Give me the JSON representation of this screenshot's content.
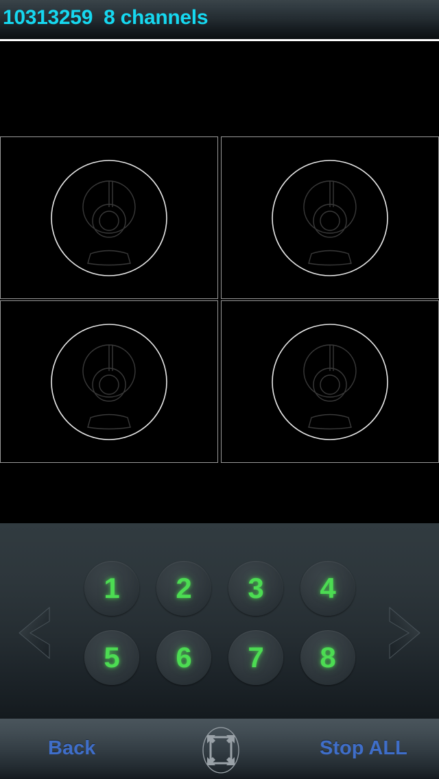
{
  "header": {
    "device_id": "10313259",
    "channel_count_label": "8 channels",
    "title": "10313259  8 channels",
    "title_color": "#16d8f0"
  },
  "video": {
    "layout": "2x2",
    "cells": [
      {
        "index": 1,
        "placeholder_icon": "webcam-icon",
        "signal": "no-video"
      },
      {
        "index": 2,
        "placeholder_icon": "webcam-icon",
        "signal": "no-video"
      },
      {
        "index": 3,
        "placeholder_icon": "webcam-icon",
        "signal": "no-video"
      },
      {
        "index": 4,
        "placeholder_icon": "webcam-icon",
        "signal": "no-video"
      }
    ]
  },
  "controls": {
    "prev_icon": "chevron-left-icon",
    "next_icon": "chevron-right-icon",
    "channels": [
      {
        "label": "1"
      },
      {
        "label": "2"
      },
      {
        "label": "3"
      },
      {
        "label": "4"
      },
      {
        "label": "5"
      },
      {
        "label": "6"
      },
      {
        "label": "7"
      },
      {
        "label": "8"
      }
    ],
    "channel_color": "#4cdc52"
  },
  "toolbar": {
    "back_label": "Back",
    "fullscreen_icon": "fullscreen-expand-icon",
    "stop_all_label": "Stop ALL",
    "link_color": "#3f6ec9"
  }
}
